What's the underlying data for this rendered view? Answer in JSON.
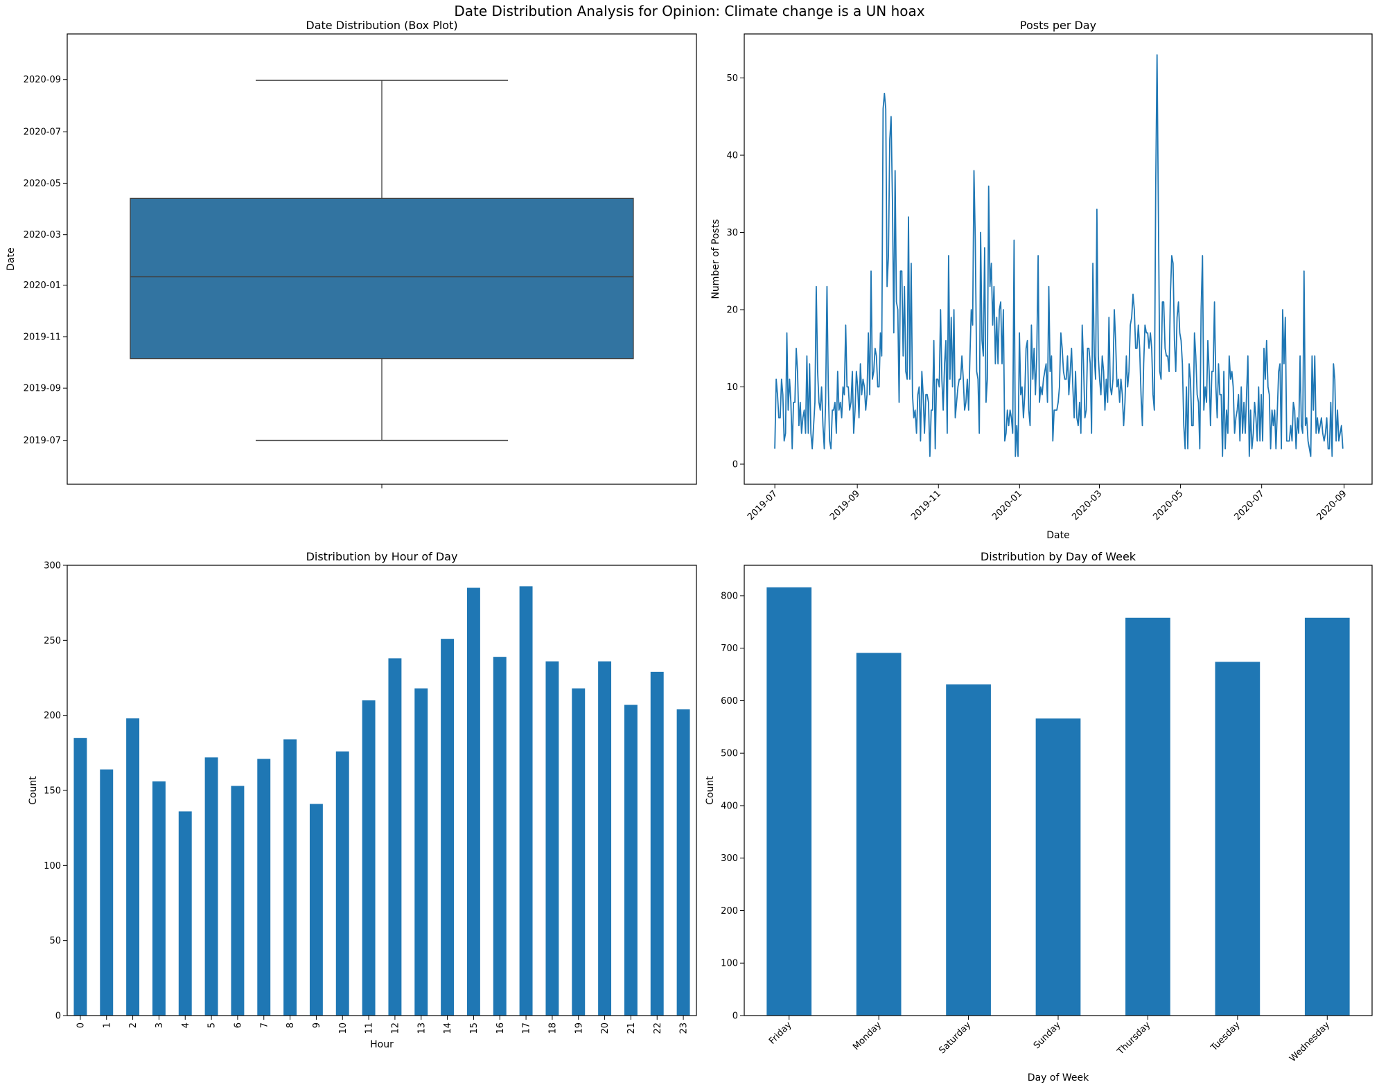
{
  "figure": {
    "suptitle": "Date Distribution Analysis for Opinion: Climate change is a UN hoax",
    "bar_color": "#1f77b4",
    "box_color": "#3274a1",
    "line_color": "#1f77b4"
  },
  "chart_data": [
    {
      "id": "boxplot",
      "type": "box",
      "title": "Date Distribution (Box Plot)",
      "xlabel": "",
      "ylabel": "Date",
      "y_ticks": [
        "2019-07",
        "2019-09",
        "2019-11",
        "2020-01",
        "2020-03",
        "2020-05",
        "2020-07",
        "2020-09"
      ],
      "ylim": [
        "2019-05-10",
        "2020-10-25"
      ],
      "stats": {
        "whisker_low": "2019-07-01",
        "q1": "2019-10-06",
        "median": "2020-01-11",
        "q3": "2020-04-13",
        "whisker_high": "2020-08-31"
      }
    },
    {
      "id": "posts_per_day",
      "type": "line",
      "title": "Posts per Day",
      "xlabel": "Date",
      "ylabel": "Number of Posts",
      "x_start": "2019-07-01",
      "x_end": "2020-08-31",
      "xlim": [
        "2019-06-08",
        "2020-09-22"
      ],
      "ylim": [
        -2.6,
        55.7
      ],
      "y_ticks": [
        0,
        10,
        20,
        30,
        40,
        50
      ],
      "x_ticks": [
        "2019-07",
        "2019-09",
        "2019-11",
        "2020-01",
        "2020-03",
        "2020-05",
        "2020-07",
        "2020-09"
      ],
      "series": [
        {
          "name": "Posts per Day",
          "values": [
            2,
            11,
            9,
            6,
            6,
            11,
            9,
            3,
            4,
            17,
            7,
            11,
            8,
            2,
            8,
            8,
            15,
            12,
            5,
            8,
            4,
            6,
            7,
            4,
            14,
            4,
            13,
            4,
            2,
            5,
            8,
            23,
            12,
            8,
            7,
            10,
            5,
            2,
            8,
            23,
            10,
            3,
            2,
            7,
            7,
            8,
            4,
            12,
            7,
            8,
            6,
            10,
            9,
            18,
            10,
            10,
            7,
            8,
            12,
            4,
            7,
            12,
            10,
            6,
            13,
            9,
            11,
            10,
            7,
            9,
            17,
            9,
            25,
            11,
            12,
            15,
            14,
            10,
            10,
            17,
            14,
            46,
            48,
            46,
            23,
            27,
            42,
            45,
            34,
            17,
            38,
            21,
            20,
            8,
            25,
            25,
            14,
            23,
            12,
            11,
            32,
            11,
            26,
            9,
            6,
            7,
            4,
            9,
            10,
            3,
            12,
            9,
            4,
            9,
            9,
            8,
            1,
            7,
            7,
            16,
            2,
            11,
            11,
            10,
            20,
            11,
            7,
            13,
            16,
            4,
            27,
            11,
            19,
            10,
            20,
            6,
            8,
            10,
            11,
            11,
            14,
            11,
            7,
            8,
            11,
            7,
            14,
            20,
            18,
            38,
            29,
            12,
            11,
            4,
            30,
            16,
            14,
            28,
            8,
            11,
            36,
            23,
            26,
            18,
            23,
            13,
            19,
            13,
            20,
            21,
            13,
            20,
            3,
            4,
            7,
            5,
            7,
            6,
            4,
            29,
            1,
            5,
            1,
            17,
            9,
            10,
            6,
            9,
            15,
            16,
            7,
            5,
            18,
            11,
            15,
            9,
            14,
            27,
            8,
            10,
            9,
            11,
            12,
            13,
            8,
            23,
            12,
            14,
            3,
            7,
            7,
            7,
            8,
            10,
            17,
            15,
            12,
            11,
            11,
            14,
            9,
            12,
            15,
            10,
            6,
            12,
            6,
            5,
            8,
            4,
            18,
            13,
            6,
            7,
            15,
            15,
            13,
            4,
            26,
            14,
            11,
            33,
            14,
            11,
            9,
            14,
            12,
            7,
            11,
            8,
            19,
            10,
            9,
            11,
            20,
            16,
            10,
            11,
            8,
            11,
            9,
            5,
            8,
            14,
            10,
            12,
            18,
            19,
            22,
            20,
            15,
            15,
            18,
            15,
            9,
            5,
            13,
            18,
            17,
            17,
            15,
            17,
            15,
            9,
            7,
            36,
            53,
            33,
            12,
            11,
            21,
            21,
            15,
            14,
            14,
            12,
            22,
            27,
            26,
            16,
            12,
            19,
            21,
            17,
            16,
            13,
            5,
            2,
            10,
            2,
            13,
            11,
            5,
            5,
            17,
            14,
            9,
            8,
            2,
            20,
            27,
            7,
            10,
            8,
            16,
            12,
            5,
            12,
            12,
            21,
            10,
            6,
            13,
            9,
            9,
            1,
            12,
            2,
            7,
            4,
            14,
            11,
            12,
            10,
            4,
            6,
            7,
            9,
            3,
            10,
            4,
            8,
            4,
            9,
            14,
            1,
            7,
            2,
            4,
            8,
            6,
            3,
            10,
            3,
            9,
            3,
            15,
            11,
            16,
            10,
            9,
            2,
            7,
            5,
            7,
            2,
            7,
            12,
            13,
            2,
            20,
            13,
            19,
            3,
            3,
            3,
            5,
            3,
            8,
            7,
            2,
            6,
            4,
            14,
            5,
            4,
            25,
            5,
            6,
            3,
            2,
            1,
            14,
            7,
            14,
            4,
            6,
            4,
            5,
            6,
            4,
            3,
            4,
            6,
            2,
            2,
            8,
            1,
            13,
            11,
            3,
            7,
            3,
            4,
            5,
            2
          ]
        }
      ]
    },
    {
      "id": "hour_of_day",
      "type": "bar",
      "title": "Distribution by Hour of Day",
      "xlabel": "Hour",
      "ylabel": "Count",
      "ylim": [
        0,
        300
      ],
      "y_ticks": [
        0,
        50,
        100,
        150,
        200,
        250,
        300
      ],
      "categories": [
        "0",
        "1",
        "2",
        "3",
        "4",
        "5",
        "6",
        "7",
        "8",
        "9",
        "10",
        "11",
        "12",
        "13",
        "14",
        "15",
        "16",
        "17",
        "18",
        "19",
        "20",
        "21",
        "22",
        "23"
      ],
      "values": [
        185,
        164,
        198,
        156,
        136,
        172,
        153,
        171,
        184,
        141,
        176,
        210,
        238,
        218,
        251,
        285,
        239,
        286,
        236,
        218,
        236,
        207,
        229,
        204
      ]
    },
    {
      "id": "day_of_week",
      "type": "bar",
      "title": "Distribution by Day of Week",
      "xlabel": "Day of Week",
      "ylabel": "Count",
      "ylim": [
        0,
        858
      ],
      "y_ticks": [
        0,
        100,
        200,
        300,
        400,
        500,
        600,
        700,
        800
      ],
      "categories": [
        "Friday",
        "Monday",
        "Saturday",
        "Sunday",
        "Thursday",
        "Tuesday",
        "Wednesday"
      ],
      "values": [
        816,
        691,
        631,
        566,
        758,
        674,
        758
      ]
    }
  ]
}
